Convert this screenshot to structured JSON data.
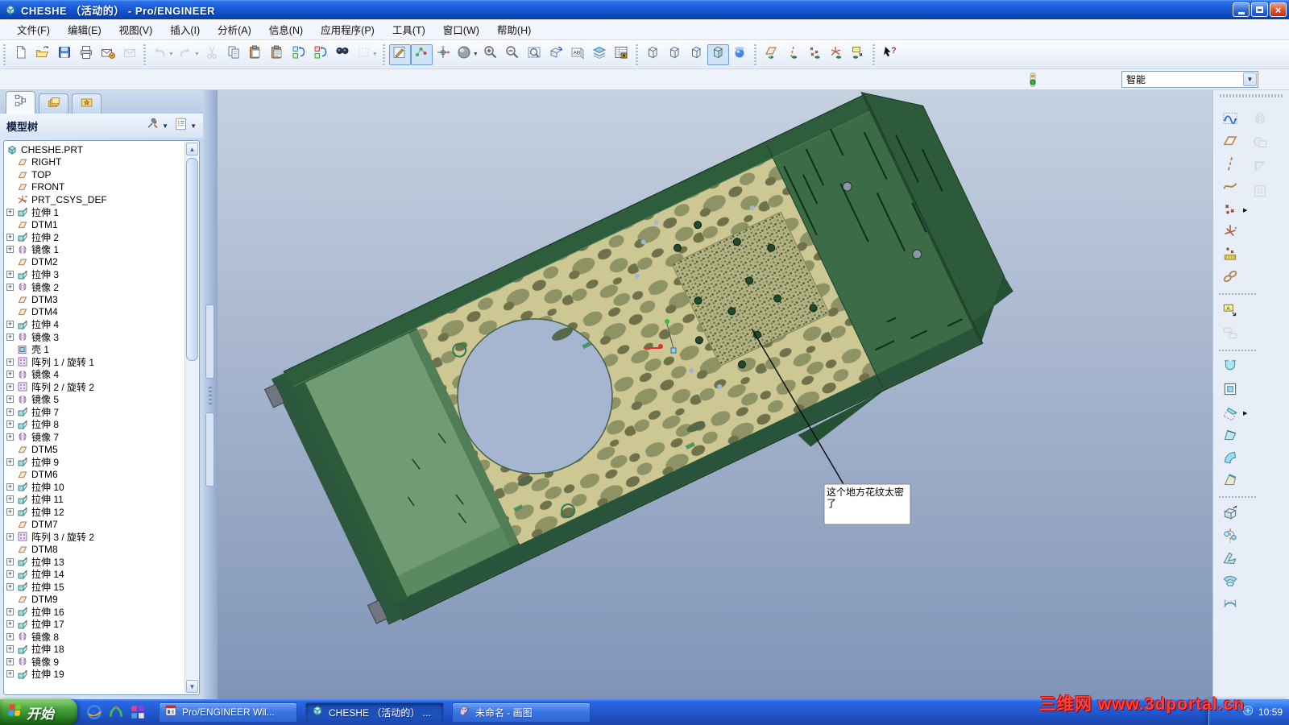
{
  "window": {
    "title": "CHESHE （活动的） - Pro/ENGINEER"
  },
  "menu": {
    "items": [
      "文件(F)",
      "编辑(E)",
      "视图(V)",
      "插入(I)",
      "分析(A)",
      "信息(N)",
      "应用程序(P)",
      "工具(T)",
      "窗口(W)",
      "帮助(H)"
    ]
  },
  "glyphs": {
    "dropdown": "▼",
    "flyout": "▶",
    "plus": "+",
    "up": "▲",
    "down": "▼",
    "close": "×"
  },
  "toolbar": {
    "groups": [
      [
        {
          "n": "new-file"
        },
        {
          "n": "open"
        },
        {
          "n": "save"
        },
        {
          "n": "print"
        },
        {
          "n": "send-email"
        },
        {
          "n": "mail-link",
          "disabled": true
        }
      ],
      [
        {
          "n": "undo",
          "disabled": true,
          "dd": true
        },
        {
          "n": "redo",
          "disabled": true,
          "dd": true
        },
        {
          "n": "cut",
          "disabled": true
        },
        {
          "n": "copy"
        },
        {
          "n": "paste"
        },
        {
          "n": "paste-special"
        },
        {
          "n": "regenerate"
        },
        {
          "n": "custom-regenerate"
        },
        {
          "n": "find"
        },
        {
          "n": "select-by-menu",
          "disabled": true,
          "dd": true
        }
      ],
      [
        {
          "n": "sketcher-display",
          "pressed": true
        },
        {
          "n": "datum-display",
          "pressed": true
        },
        {
          "n": "spin-center"
        },
        {
          "n": "shading",
          "dd": true
        },
        {
          "n": "zoom-in"
        },
        {
          "n": "zoom-out"
        },
        {
          "n": "refit"
        },
        {
          "n": "reorient"
        },
        {
          "n": "saved-views"
        },
        {
          "n": "layers"
        },
        {
          "n": "view-manager"
        }
      ],
      [
        {
          "n": "wireframe"
        },
        {
          "n": "hidden-line"
        },
        {
          "n": "no-hidden"
        },
        {
          "n": "shaded",
          "pressed": true
        },
        {
          "n": "realism"
        }
      ],
      [
        {
          "n": "plane-display"
        },
        {
          "n": "axis-display"
        },
        {
          "n": "point-display"
        },
        {
          "n": "csys-display"
        },
        {
          "n": "annotation-display"
        }
      ],
      [
        {
          "n": "context-help"
        }
      ]
    ]
  },
  "filter_bar": {
    "value": "智能"
  },
  "model_tree": {
    "title": "模型树",
    "tabs": [
      {
        "icon": "model-tree-tab",
        "active": true
      },
      {
        "icon": "folder-browser-tab",
        "active": false
      },
      {
        "icon": "favorites-tab",
        "active": false
      }
    ],
    "header_buttons": [
      {
        "icon": "tree-filters"
      },
      {
        "icon": "tree-columns"
      }
    ],
    "items": [
      {
        "icon": "part",
        "label": "CHESHE.PRT",
        "root": true
      },
      {
        "icon": "plane",
        "label": "RIGHT"
      },
      {
        "icon": "plane",
        "label": "TOP"
      },
      {
        "icon": "plane",
        "label": "FRONT"
      },
      {
        "icon": "csys",
        "label": "PRT_CSYS_DEF"
      },
      {
        "icon": "extrude",
        "label": "拉伸 1",
        "expandable": true
      },
      {
        "icon": "plane",
        "label": "DTM1"
      },
      {
        "icon": "extrude",
        "label": "拉伸 2",
        "expandable": true
      },
      {
        "icon": "mirror",
        "label": "镜像 1",
        "expandable": true
      },
      {
        "icon": "plane",
        "label": "DTM2"
      },
      {
        "icon": "extrude",
        "label": "拉伸 3",
        "expandable": true
      },
      {
        "icon": "mirror",
        "label": "镜像 2",
        "expandable": true
      },
      {
        "icon": "plane",
        "label": "DTM3"
      },
      {
        "icon": "plane",
        "label": "DTM4"
      },
      {
        "icon": "extrude",
        "label": "拉伸 4",
        "expandable": true
      },
      {
        "icon": "mirror",
        "label": "镜像 3",
        "expandable": true
      },
      {
        "icon": "shell",
        "label": "壳 1"
      },
      {
        "icon": "pattern",
        "label": "阵列 1 / 旋转 1",
        "expandable": true
      },
      {
        "icon": "mirror",
        "label": "镜像 4",
        "expandable": true
      },
      {
        "icon": "pattern",
        "label": "阵列 2 / 旋转 2",
        "expandable": true
      },
      {
        "icon": "mirror",
        "label": "镜像 5",
        "expandable": true
      },
      {
        "icon": "extrude",
        "label": "拉伸 7",
        "expandable": true
      },
      {
        "icon": "extrude",
        "label": "拉伸 8",
        "expandable": true
      },
      {
        "icon": "mirror",
        "label": "镜像 7",
        "expandable": true
      },
      {
        "icon": "plane",
        "label": "DTM5"
      },
      {
        "icon": "extrude",
        "label": "拉伸 9",
        "expandable": true
      },
      {
        "icon": "plane",
        "label": "DTM6"
      },
      {
        "icon": "extrude",
        "label": "拉伸 10",
        "expandable": true
      },
      {
        "icon": "extrude",
        "label": "拉伸 11",
        "expandable": true
      },
      {
        "icon": "extrude",
        "label": "拉伸 12",
        "expandable": true
      },
      {
        "icon": "plane",
        "label": "DTM7"
      },
      {
        "icon": "pattern",
        "label": "阵列 3 / 旋转 2",
        "expandable": true
      },
      {
        "icon": "plane",
        "label": "DTM8"
      },
      {
        "icon": "extrude",
        "label": "拉伸 13",
        "expandable": true
      },
      {
        "icon": "extrude",
        "label": "拉伸 14",
        "expandable": true
      },
      {
        "icon": "extrude",
        "label": "拉伸 15",
        "expandable": true
      },
      {
        "icon": "plane",
        "label": "DTM9"
      },
      {
        "icon": "extrude",
        "label": "拉伸 16",
        "expandable": true
      },
      {
        "icon": "extrude",
        "label": "拉伸 17",
        "expandable": true
      },
      {
        "icon": "mirror",
        "label": "镜像 8",
        "expandable": true
      },
      {
        "icon": "extrude",
        "label": "拉伸 18",
        "expandable": true
      },
      {
        "icon": "mirror",
        "label": "镜像 9",
        "expandable": true
      },
      {
        "icon": "extrude",
        "label": "拉伸 19",
        "expandable": true
      }
    ]
  },
  "viewport": {
    "annotation": {
      "text": "这个地方花纹太密了",
      "lines": [
        "这个地方花纹太密",
        "了"
      ]
    },
    "colors": {
      "background_top": "#c6d1e0",
      "background_bottom": "#8094b7",
      "hull_dark_green": "#2d5b3a",
      "deck_green": "#3b6c46",
      "panel_green": "#6f9c72",
      "camo_base": "#cdc893",
      "camo_olive": "#8e9365",
      "camo_dark": "#6e7149",
      "turret_ring": "#a7b6d0"
    }
  },
  "right_toolbar": {
    "items": [
      {
        "n": "style-tool"
      },
      {
        "n": "plane-tool"
      },
      {
        "n": "axis-tool"
      },
      {
        "n": "curve-tool"
      },
      {
        "n": "point-tool",
        "fly": true
      },
      {
        "n": "csys-tool"
      },
      {
        "n": "sketch-point-tool"
      },
      {
        "n": "ref-tool"
      },
      {
        "sep": true
      },
      {
        "n": "annotation-tool"
      },
      {
        "n": "note-tool",
        "disabled": true
      },
      {
        "sep": true
      },
      {
        "n": "hole-tool"
      },
      {
        "n": "shell-tool"
      },
      {
        "n": "rib-tool",
        "fly": true
      },
      {
        "n": "draft-tool"
      },
      {
        "n": "round-tool"
      },
      {
        "n": "chamfer-tool"
      },
      {
        "sep": true
      },
      {
        "n": "extrude-tool"
      },
      {
        "n": "revolve-tool"
      },
      {
        "n": "sweep-tool"
      },
      {
        "n": "blend-tool"
      },
      {
        "n": "boundary-blend-tool"
      }
    ],
    "secondary": [
      {
        "n": "mirror-tool",
        "disabled": true
      },
      {
        "n": "merge-tool",
        "disabled": true
      },
      {
        "n": "trim-tool",
        "disabled": true
      },
      {
        "n": "pattern-tool",
        "disabled": true
      }
    ]
  },
  "taskbar": {
    "start_label": "开始",
    "quick_launch": [
      "ie-icon",
      "msn-icon",
      "grid-icon"
    ],
    "tasks": [
      {
        "icon": "proe-icon",
        "label": "Pro/ENGINEER Wil...",
        "active": false
      },
      {
        "icon": "part-icon",
        "label": "CHESHE （活动的） ...",
        "active": true
      },
      {
        "icon": "paint-icon",
        "label": "未命名 - 画图",
        "active": false
      }
    ],
    "tray_time": "10:59"
  },
  "watermark": {
    "text": "三维网 www.3dportal.cn",
    "color": "#ff4238"
  }
}
